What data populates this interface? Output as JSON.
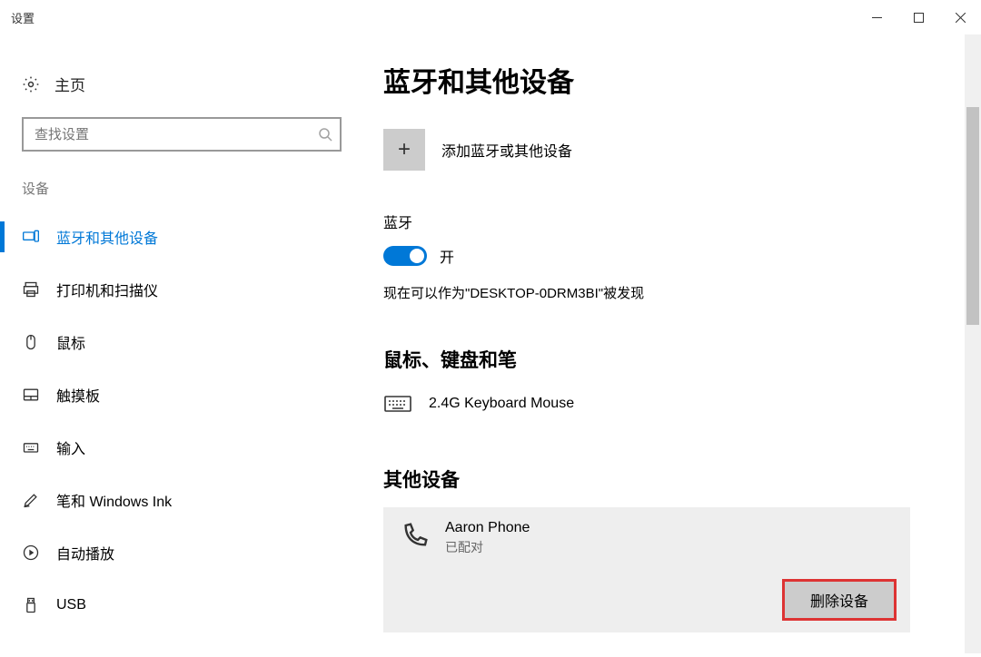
{
  "window": {
    "title": "设置"
  },
  "sidebar": {
    "home_label": "主页",
    "search_placeholder": "查找设置",
    "group_label": "设备",
    "items": [
      {
        "label": "蓝牙和其他设备"
      },
      {
        "label": "打印机和扫描仪"
      },
      {
        "label": "鼠标"
      },
      {
        "label": "触摸板"
      },
      {
        "label": "输入"
      },
      {
        "label": "笔和 Windows Ink"
      },
      {
        "label": "自动播放"
      },
      {
        "label": "USB"
      }
    ]
  },
  "main": {
    "title": "蓝牙和其他设备",
    "add_label": "添加蓝牙或其他设备",
    "bt_label": "蓝牙",
    "toggle_state": "开",
    "discover_text": "现在可以作为\"DESKTOP-0DRM3BI\"被发现",
    "section_mouse": "鼠标、键盘和笔",
    "device_keyboard": "2.4G Keyboard Mouse",
    "section_other": "其他设备",
    "selected": {
      "name": "Aaron Phone",
      "status": "已配对"
    },
    "remove_button": "删除设备"
  }
}
